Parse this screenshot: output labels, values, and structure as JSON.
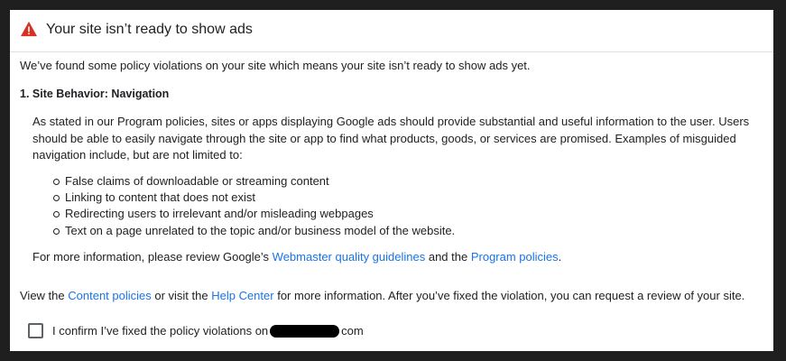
{
  "header": {
    "title": "Your site isn’t ready to show ads",
    "icon": "warning-icon",
    "icon_color": "#d93025"
  },
  "intro": "We’ve found some policy violations on your site which means your site isn’t ready to show ads yet.",
  "violation": {
    "title": "1. Site Behavior: Navigation",
    "description": "As stated in our Program policies, sites or apps displaying Google ads should provide substantial and useful information to the user. Users should be able to easily navigate through the site or app to find what products, goods, or services are promised. Examples of misguided navigation include, but are not limited to:",
    "examples": [
      "False claims of downloadable or streaming content",
      "Linking to content that does not exist",
      "Redirecting users to irrelevant and/or misleading webpages",
      "Text on a page unrelated to the topic and/or business model of the website."
    ],
    "more_info": {
      "prefix": "For more information, please review Google’s ",
      "link1": "Webmaster quality guidelines",
      "middle": " and the ",
      "link2": "Program policies",
      "suffix": "."
    }
  },
  "footer": {
    "prefix": "View the ",
    "link1": "Content policies",
    "middle": " or visit the ",
    "link2": "Help Center",
    "suffix": " for more information. After you’ve fixed the violation, you can request a review of your site."
  },
  "confirm": {
    "label_prefix": "I confirm I’ve fixed the policy violations on ",
    "label_suffix": "com",
    "checked": false
  },
  "colors": {
    "link": "#1a73e8",
    "text": "#202124"
  }
}
